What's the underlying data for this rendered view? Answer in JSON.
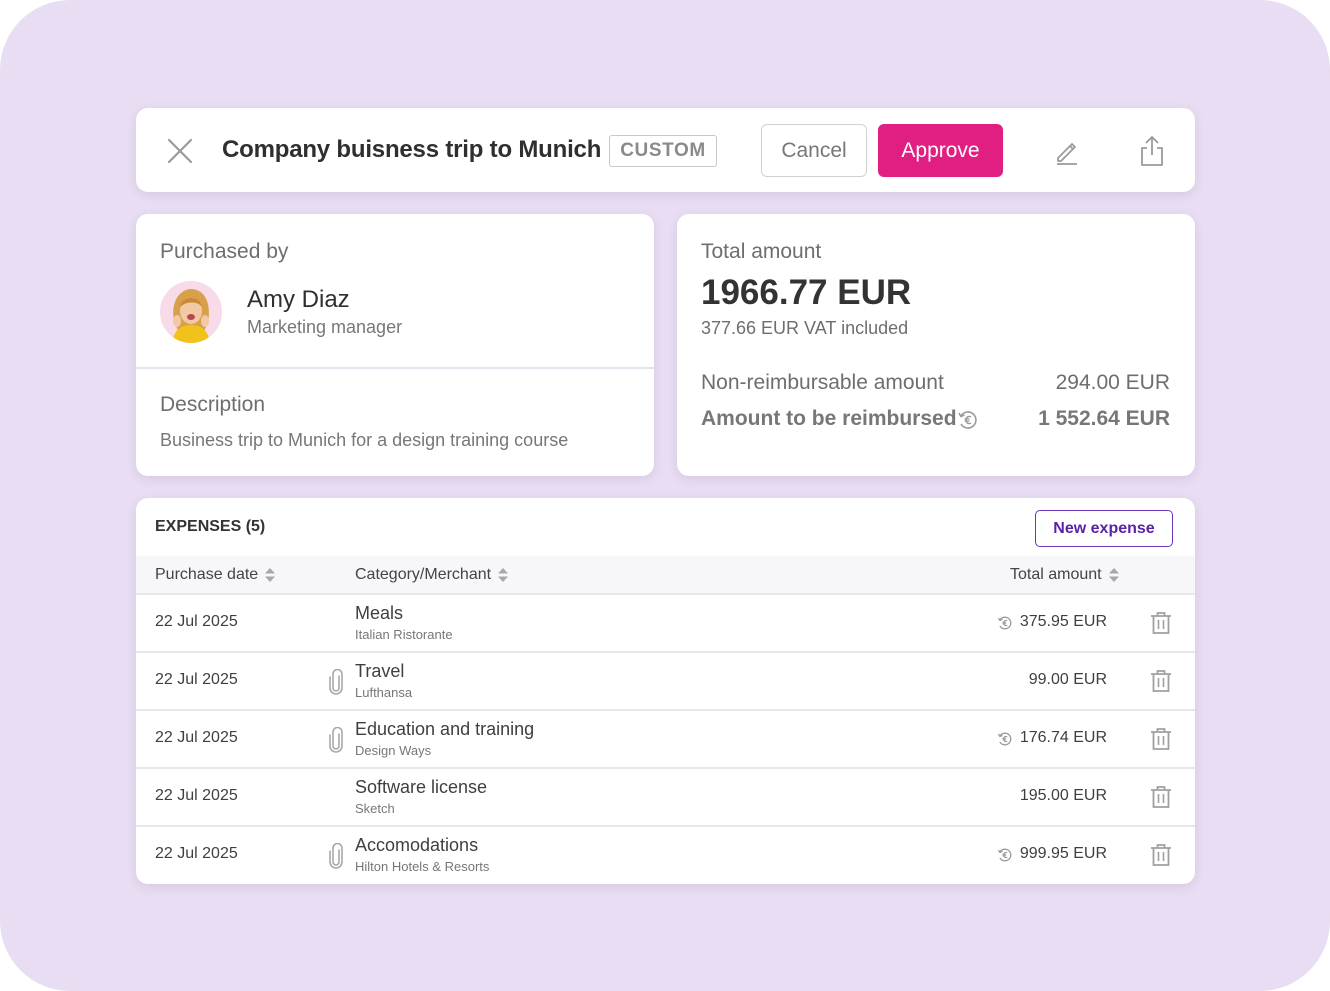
{
  "header": {
    "title": "Company buisness trip to Munich",
    "tag": "CUSTOM",
    "cancel_label": "Cancel",
    "approve_label": "Approve"
  },
  "purchaser": {
    "label": "Purchased by",
    "name": "Amy Diaz",
    "role": "Marketing manager",
    "description_label": "Description",
    "description": "Business trip to Munich for a design training course"
  },
  "totals": {
    "label": "Total amount",
    "amount": "1966.77 EUR",
    "vat": "377.66 EUR VAT included",
    "non_reimbursable_label": "Non-reimbursable amount",
    "non_reimbursable_value": "294.00 EUR",
    "reimbursed_label": "Amount to be reimbursed",
    "reimbursed_value": "1 552.64 EUR"
  },
  "expenses": {
    "title": "EXPENSES (5)",
    "new_button": "New expense",
    "columns": [
      "Purchase date",
      "Category/Merchant",
      "Total amount"
    ],
    "rows": [
      {
        "date": "22 Jul 2025",
        "category": "Meals",
        "merchant": "Italian Ristorante",
        "amount": "375.95 EUR",
        "attachment": false,
        "reimbursable": true
      },
      {
        "date": "22 Jul 2025",
        "category": "Travel",
        "merchant": "Lufthansa",
        "amount": "99.00 EUR",
        "attachment": true,
        "reimbursable": false
      },
      {
        "date": "22 Jul 2025",
        "category": "Education and training",
        "merchant": "Design Ways",
        "amount": "176.74 EUR",
        "attachment": true,
        "reimbursable": true
      },
      {
        "date": "22 Jul 2025",
        "category": "Software license",
        "merchant": "Sketch",
        "amount": "195.00 EUR",
        "attachment": false,
        "reimbursable": false
      },
      {
        "date": "22 Jul 2025",
        "category": "Accomodations",
        "merchant": "Hilton Hotels & Resorts",
        "amount": "999.95 EUR",
        "attachment": true,
        "reimbursable": true
      }
    ]
  },
  "colors": {
    "accent": "#e11f82",
    "secondary": "#5a22a8",
    "background": "#e8ddf2"
  },
  "icons": [
    "close-icon",
    "edit-icon",
    "share-icon",
    "reimbursable-euro-icon",
    "paperclip-icon",
    "trash-icon",
    "sort-icon"
  ]
}
